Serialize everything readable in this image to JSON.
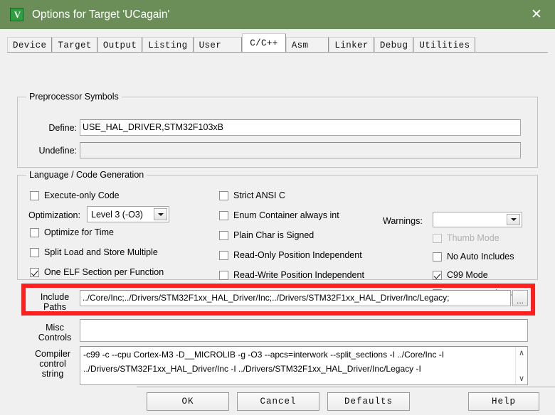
{
  "window": {
    "title": "Options for Target 'UCagain'",
    "icon": "keil-uvision-icon",
    "icon_glyph": "V",
    "close_label": "✕",
    "titlebar_color": "#6b8e59"
  },
  "tabs": [
    {
      "label": "Device",
      "active": false
    },
    {
      "label": "Target",
      "active": false
    },
    {
      "label": "Output",
      "active": false
    },
    {
      "label": "Listing",
      "active": false
    },
    {
      "label": "User",
      "active": false
    },
    {
      "label": "C/C++",
      "active": true
    },
    {
      "label": "Asm",
      "active": false
    },
    {
      "label": "Linker",
      "active": false
    },
    {
      "label": "Debug",
      "active": false
    },
    {
      "label": "Utilities",
      "active": false
    }
  ],
  "preprocessor": {
    "legend": "Preprocessor Symbols",
    "define_label": "Define:",
    "define_value": "USE_HAL_DRIVER,STM32F103xB",
    "undefine_label": "Undefine:",
    "undefine_value": ""
  },
  "language": {
    "legend": "Language / Code Generation",
    "left_column": [
      {
        "label": "Execute-only Code",
        "checked": false,
        "disabled": false
      },
      {
        "label": "Optimize for Time",
        "checked": false,
        "disabled": false
      },
      {
        "label": "Split Load and Store Multiple",
        "checked": false,
        "disabled": false
      },
      {
        "label": "One ELF Section per Function",
        "checked": true,
        "disabled": false
      }
    ],
    "optimization_label": "Optimization:",
    "optimization_value": "Level 3 (-O3)",
    "middle_column": [
      {
        "label": "Strict ANSI C",
        "checked": false,
        "disabled": false
      },
      {
        "label": "Enum Container always int",
        "checked": false,
        "disabled": false
      },
      {
        "label": "Plain Char is Signed",
        "checked": false,
        "disabled": false
      },
      {
        "label": "Read-Only Position Independent",
        "checked": false,
        "disabled": false
      },
      {
        "label": "Read-Write Position Independent",
        "checked": false,
        "disabled": false
      }
    ],
    "warnings_label": "Warnings:",
    "warnings_value": "",
    "right_column": [
      {
        "label": "Thumb Mode",
        "checked": false,
        "disabled": true
      },
      {
        "label": "No Auto Includes",
        "checked": false,
        "disabled": false
      },
      {
        "label": "C99 Mode",
        "checked": true,
        "disabled": false
      },
      {
        "label": "GNU extensions",
        "checked": false,
        "disabled": false
      }
    ]
  },
  "include_paths": {
    "label_line1": "Include",
    "label_line2": "Paths",
    "value": "../Core/Inc;../Drivers/STM32F1xx_HAL_Driver/Inc;../Drivers/STM32F1xx_HAL_Driver/Inc/Legacy;",
    "browse_label": "...",
    "highlight_color": "#ff1f1f"
  },
  "misc_controls": {
    "label_line1": "Misc",
    "label_line2": "Controls",
    "value": ""
  },
  "compiler_control": {
    "label_line1": "Compiler",
    "label_line2": "control",
    "label_line3": "string",
    "line1": "-c99 -c --cpu Cortex-M3 -D__MICROLIB -g -O3 --apcs=interwork --split_sections -I ../Core/Inc -I",
    "line2": "../Drivers/STM32F1xx_HAL_Driver/Inc -I ../Drivers/STM32F1xx_HAL_Driver/Inc/Legacy -I",
    "scroll_up": "∧",
    "scroll_down": "∨"
  },
  "buttons": {
    "ok": "OK",
    "cancel": "Cancel",
    "defaults": "Defaults",
    "help": "Help"
  }
}
